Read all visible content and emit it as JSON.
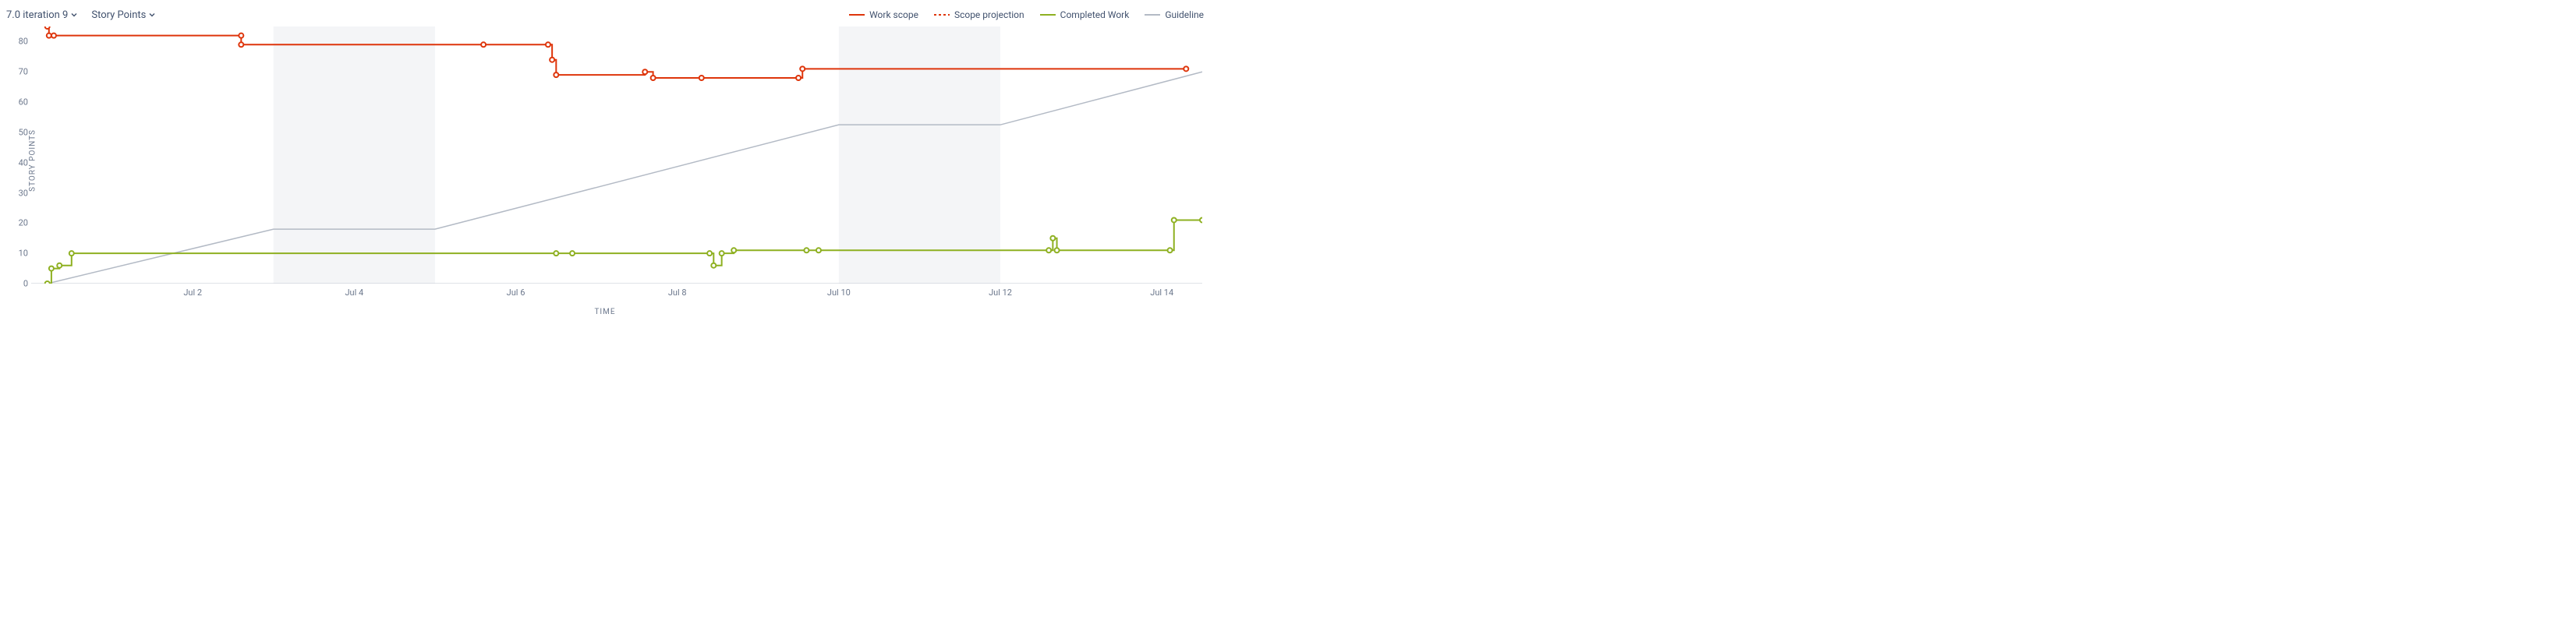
{
  "header": {
    "sprint_dropdown_label": "7.0 iteration 9",
    "metric_dropdown_label": "Story Points"
  },
  "legend": {
    "work_scope": "Work scope",
    "scope_projection": "Scope projection",
    "completed_work": "Completed Work",
    "guideline": "Guideline"
  },
  "axis": {
    "ylabel": "STORY POINTS",
    "xlabel": "TIME"
  },
  "colors": {
    "work_scope": "#de350b",
    "scope_projection": "#de350b",
    "completed_work": "#8eb021",
    "guideline": "#b3bac5",
    "weekend_band": "#f4f5f7",
    "axis": "#c1c7d0",
    "tick_text": "#6b778c"
  },
  "chart_data": {
    "type": "line",
    "xlabel": "TIME",
    "ylabel": "STORY POINTS",
    "ylim": [
      0,
      85
    ],
    "x_domain_days": [
      0,
      14.5
    ],
    "x_ticks": [
      {
        "day": 2,
        "label": "Jul 2"
      },
      {
        "day": 4,
        "label": "Jul 4"
      },
      {
        "day": 6,
        "label": "Jul 6"
      },
      {
        "day": 8,
        "label": "Jul 8"
      },
      {
        "day": 10,
        "label": "Jul 10"
      },
      {
        "day": 12,
        "label": "Jul 12"
      },
      {
        "day": 14,
        "label": "Jul 14"
      }
    ],
    "y_ticks": [
      0,
      10,
      20,
      30,
      40,
      50,
      60,
      70,
      80
    ],
    "weekend_bands": [
      [
        3,
        5
      ],
      [
        10,
        12
      ]
    ],
    "series": [
      {
        "name": "Guideline",
        "color_key": "guideline",
        "style": "solid",
        "markers": false,
        "points": [
          {
            "x": 0.2,
            "y": 0
          },
          {
            "x": 3.0,
            "y": 18
          },
          {
            "x": 5.0,
            "y": 18
          },
          {
            "x": 10.0,
            "y": 52.5
          },
          {
            "x": 12.0,
            "y": 52.5
          },
          {
            "x": 14.5,
            "y": 70
          }
        ]
      },
      {
        "name": "Work scope",
        "color_key": "work_scope",
        "style": "solid-step",
        "markers": true,
        "points": [
          {
            "x": 0.2,
            "y": 85
          },
          {
            "x": 0.22,
            "y": 82
          },
          {
            "x": 0.28,
            "y": 82
          },
          {
            "x": 2.6,
            "y": 82
          },
          {
            "x": 2.6,
            "y": 79
          },
          {
            "x": 5.6,
            "y": 79
          },
          {
            "x": 6.4,
            "y": 79
          },
          {
            "x": 6.45,
            "y": 74
          },
          {
            "x": 6.5,
            "y": 69
          },
          {
            "x": 7.6,
            "y": 70
          },
          {
            "x": 7.7,
            "y": 68
          },
          {
            "x": 8.3,
            "y": 68
          },
          {
            "x": 9.5,
            "y": 68
          },
          {
            "x": 9.55,
            "y": 71
          },
          {
            "x": 14.3,
            "y": 71
          }
        ]
      },
      {
        "name": "Completed Work",
        "color_key": "completed_work",
        "style": "solid-step",
        "markers": true,
        "points": [
          {
            "x": 0.2,
            "y": 0
          },
          {
            "x": 0.25,
            "y": 5
          },
          {
            "x": 0.35,
            "y": 6
          },
          {
            "x": 0.5,
            "y": 10
          },
          {
            "x": 6.5,
            "y": 10
          },
          {
            "x": 6.7,
            "y": 10
          },
          {
            "x": 8.4,
            "y": 10
          },
          {
            "x": 8.45,
            "y": 6
          },
          {
            "x": 8.55,
            "y": 10
          },
          {
            "x": 8.7,
            "y": 11
          },
          {
            "x": 9.6,
            "y": 11
          },
          {
            "x": 9.75,
            "y": 11
          },
          {
            "x": 12.6,
            "y": 11
          },
          {
            "x": 12.65,
            "y": 15
          },
          {
            "x": 12.7,
            "y": 11
          },
          {
            "x": 14.1,
            "y": 11
          },
          {
            "x": 14.15,
            "y": 21
          },
          {
            "x": 14.5,
            "y": 21
          }
        ]
      }
    ]
  }
}
